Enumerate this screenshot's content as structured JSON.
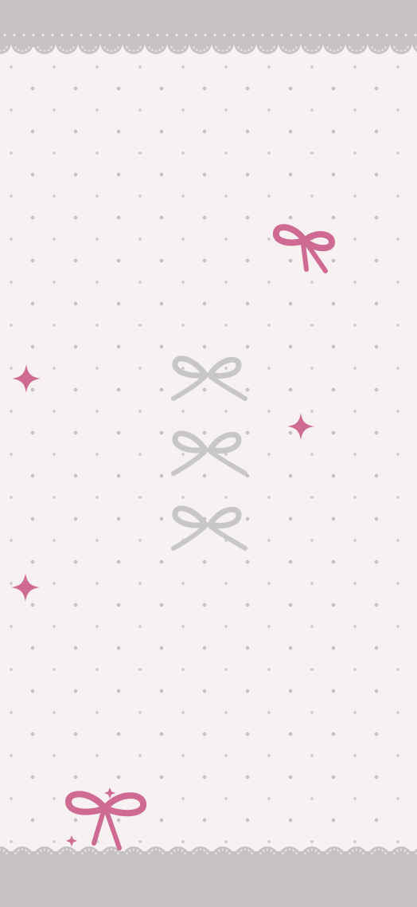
{
  "wallpaper": {
    "background_color": "#f7f1f2",
    "dot_color": "#c9c2c4",
    "band_color": "#c6c1c2",
    "lace_color": "#c8c3c4",
    "accent_pink": "#cf6b93",
    "accent_gray": "#c7c7c8"
  },
  "decorations": [
    {
      "name": "top-lace-border-icon"
    },
    {
      "name": "bottom-lace-border-icon"
    },
    {
      "name": "pink-bow-icon"
    },
    {
      "name": "gray-bow-icon"
    },
    {
      "name": "pink-sparkle-icon"
    }
  ]
}
